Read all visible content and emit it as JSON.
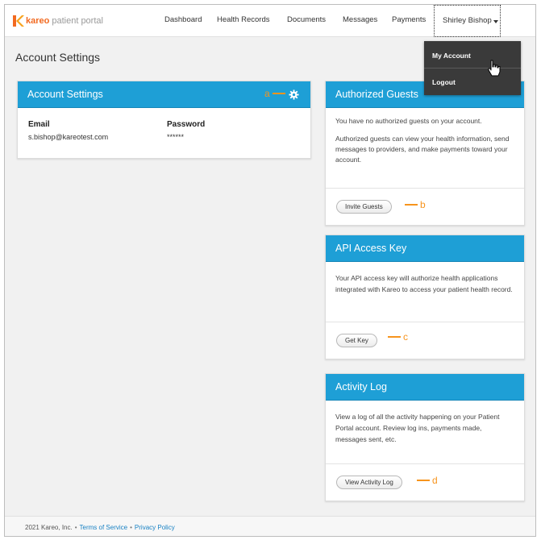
{
  "brand": {
    "name": "kareo",
    "product": "patient portal",
    "accent": "#f26a21"
  },
  "nav": {
    "items": [
      "Dashboard",
      "Health Records",
      "Documents",
      "Messages",
      "Payments"
    ],
    "user_name": "Shirley Bishop"
  },
  "user_dropdown": {
    "items": [
      "My Account",
      "Logout"
    ]
  },
  "page": {
    "title": "Account Settings"
  },
  "account_card": {
    "title": "Account Settings",
    "annotation": "a",
    "email_label": "Email",
    "email_value": "s.bishop@kareotest.com",
    "password_label": "Password",
    "password_value": "******",
    "settings_icon": "gear-icon"
  },
  "guests_card": {
    "title": "Authorized Guests",
    "text1": "You have no authorized guests on your account.",
    "text2": "Authorized guests can view your health information, send messages to providers, and make payments toward your account.",
    "button": "Invite Guests",
    "annotation": "b"
  },
  "api_card": {
    "title": "API Access Key",
    "text": "Your API access key will authorize health applications integrated with Kareo to access your patient health record.",
    "button": "Get Key",
    "annotation": "c"
  },
  "activity_card": {
    "title": "Activity Log",
    "text": "View a log of all the activity happening on your Patient Portal account. Review log ins, payments made, messages sent, etc.",
    "button": "View Activity Log",
    "annotation": "d"
  },
  "footer": {
    "copyright": "2021 Kareo, Inc.",
    "terms": "Terms of Service",
    "privacy": "Privacy Policy"
  },
  "colors": {
    "header_blue": "#1e9fd6",
    "annotation_orange": "#f7941d",
    "link_blue": "#1a82c4"
  }
}
